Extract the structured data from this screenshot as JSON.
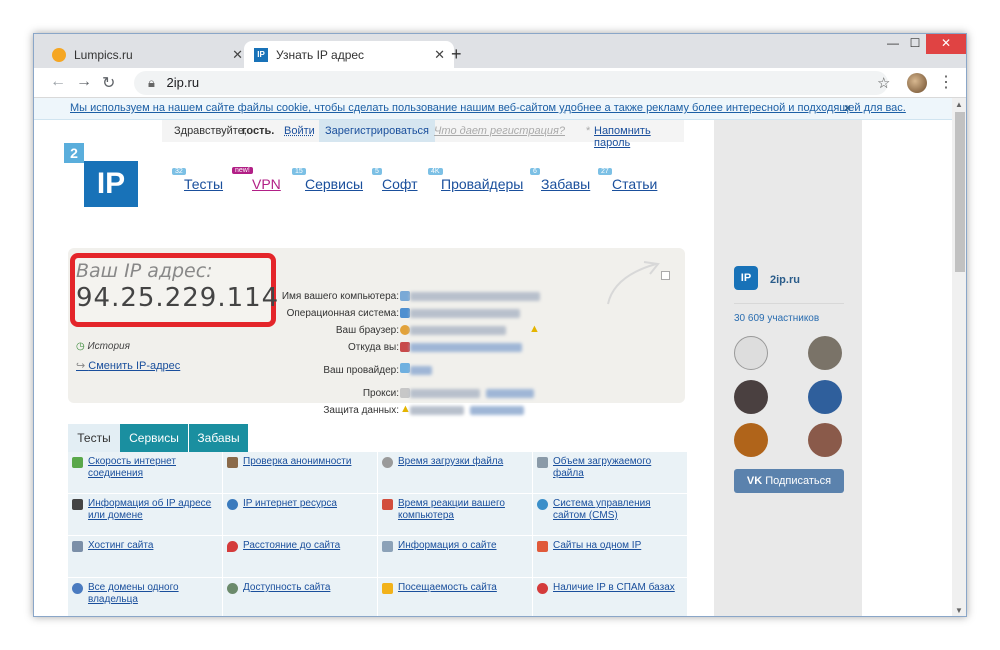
{
  "browser": {
    "tabs": [
      {
        "title": "Lumpics.ru",
        "active": false,
        "favicon": "orange-circle-icon"
      },
      {
        "title": "Узнать IP адрес",
        "active": true,
        "favicon": "2ip-icon"
      }
    ],
    "new_tab": "+",
    "url": "2ip.ru",
    "window_controls": {
      "minimize": "—",
      "maximize": "☐",
      "close": "✕"
    }
  },
  "cookie_notice": {
    "text": "Мы используем на нашем сайте файлы cookie, чтобы сделать пользование нашим веб-сайтом удобнее а также рекламу более интересной и подходящей для вас.",
    "close": "×"
  },
  "account_bar": {
    "greeting": "Здравствуйте,",
    "guest": "гость.",
    "login": "Войти",
    "register": "Зарегистрироваться",
    "why_register": "Что дает регистрация?",
    "remind_password": "Напомнить пароль"
  },
  "logo": {
    "number": "2",
    "text": "IP"
  },
  "nav": [
    {
      "label": "Тесты",
      "badge": "32"
    },
    {
      "label": "VPN",
      "badge": "new!"
    },
    {
      "label": "Сервисы",
      "badge": "15"
    },
    {
      "label": "Софт",
      "badge": "5"
    },
    {
      "label": "Провайдеры",
      "badge": "4K"
    },
    {
      "label": "Забавы",
      "badge": "6"
    },
    {
      "label": "Статьи",
      "badge": "27"
    }
  ],
  "ip_block": {
    "label": "Ваш IP адрес:",
    "value": "94.25.229.114",
    "history": "История",
    "change_ip": "Сменить IP-адрес",
    "details": [
      {
        "label": "Имя вашего компьютера:"
      },
      {
        "label": "Операционная система:"
      },
      {
        "label": "Ваш браузер:"
      },
      {
        "label": "Откуда вы:"
      },
      {
        "label": "Ваш провайдер:"
      },
      {
        "label": "Прокси:"
      },
      {
        "label": "Защита данных:"
      }
    ]
  },
  "tool_tabs": [
    "Тесты",
    "Сервисы",
    "Забавы"
  ],
  "tools": [
    [
      "Скорость интернет соединения",
      "Проверка анонимности",
      "Время загрузки файла",
      "Объем загружаемого файла"
    ],
    [
      "Информация об IP адресе или домене",
      "IP интернет ресурса",
      "Время реакции вашего компьютера",
      "Система управления сайтом (CMS)"
    ],
    [
      "Хостинг сайта",
      "Расстояние до сайта",
      "Информация о сайте",
      "Сайты на одном IP"
    ],
    [
      "Все домены одного владельца",
      "Доступность сайта",
      "Посещаемость сайта",
      "Наличие IP в СПАМ базах"
    ]
  ],
  "vk_widget": {
    "name": "2ip.ru",
    "members": "30 609 участников",
    "subscribe": "Подписаться"
  }
}
